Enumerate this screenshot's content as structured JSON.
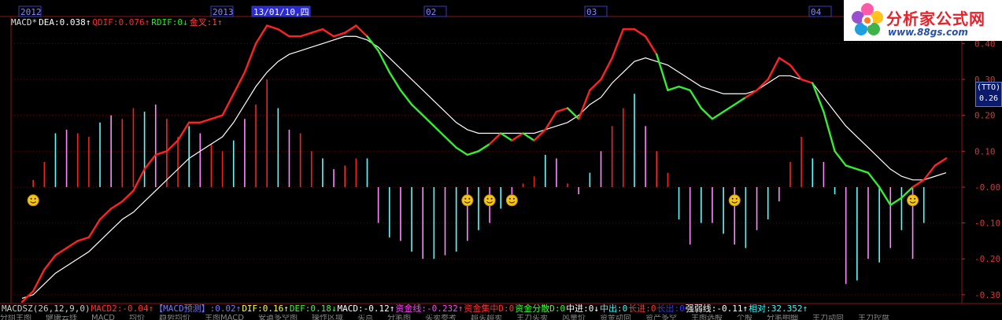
{
  "top_axis": {
    "labels": [
      "2012",
      "2013",
      "13/01/10,四",
      "02",
      "03",
      "04"
    ]
  },
  "logo": {
    "title": "分析家公式网",
    "url": "www.88gs.com"
  },
  "legend": {
    "items": [
      {
        "text": "MACD*",
        "color": "#dddddd"
      },
      {
        "text": "DEA:0.038↑",
        "color": "#ffffff"
      },
      {
        "text": "QDIF:0.076↑",
        "color": "#ff2a2a"
      },
      {
        "text": "RDIF:0↓",
        "color": "#22ee22"
      },
      {
        "text": "金叉:1↑",
        "color": "#ff4444"
      }
    ]
  },
  "price_tag": {
    "line1": "(TTO)",
    "line2": "0.26"
  },
  "footer": {
    "items": [
      {
        "text": "MACDSZ(26,12,9,0)",
        "color": "#cccccc"
      },
      {
        "text": "MACD2:-0.04↑",
        "color": "#ff3333"
      },
      {
        "text": "【MACD预测】:0.02↑",
        "color": "#7777ff"
      },
      {
        "text": "DIF:0.16↑",
        "color": "#ffff44"
      },
      {
        "text": "DEF:0.18↓",
        "color": "#33ff33"
      },
      {
        "text": "MACD:-0.12↑",
        "color": "#ffffff"
      },
      {
        "text": "资金线:-0.232↑",
        "color": "#ff44ff"
      },
      {
        "text": "资金集中D:0",
        "color": "#ff3333"
      },
      {
        "text": "资金分散D:0",
        "color": "#33ff33"
      },
      {
        "text": "中进:0↓",
        "color": "#ffffff"
      },
      {
        "text": "中出:0",
        "color": "#33ffff"
      },
      {
        "text": "长进:0",
        "color": "#ff3333"
      },
      {
        "text": "长出:0",
        "color": "#3333ff"
      },
      {
        "text": "强弱线:-0.11↑",
        "color": "#ffffff"
      },
      {
        "text": "相对:32.352↑",
        "color": "#33ffff"
      }
    ]
  },
  "tabs": {
    "items": [
      "分组主图",
      "健康云线",
      "MACD",
      "均价",
      "趋势均价",
      "主图MACD",
      "安道多空图",
      "操作区域",
      "买点",
      "分笔图",
      "买卖参考",
      "超买超卖",
      "主力买卖",
      "风量价",
      "资金动向",
      "资产多空",
      "主图选股",
      "个股",
      "分笔明细",
      "主力动向",
      "主力控盘"
    ]
  },
  "chart_data": {
    "type": "line",
    "title": "",
    "ylabel": "",
    "ylim": [
      -0.32,
      0.46
    ],
    "y_ticks": [
      "0.40",
      "0.30",
      "0.20",
      "0.10",
      "-0.00",
      "-0.10",
      "-0.20",
      "-0.30"
    ],
    "y_tick_values": [
      0.4,
      0.3,
      0.2,
      0.1,
      0.0,
      -0.1,
      -0.2,
      -0.3
    ],
    "x_range": [
      0,
      83
    ],
    "series": [
      {
        "name": "QDIF",
        "color_up": "#ff2222",
        "color_down": "#33ee33",
        "x": [
          0,
          1,
          2,
          3,
          4,
          5,
          6,
          7,
          8,
          9,
          10,
          11,
          12,
          13,
          14,
          15,
          16,
          17,
          18,
          19,
          20,
          21,
          22,
          23,
          24,
          25,
          26,
          27,
          28,
          29,
          30,
          31,
          32,
          33,
          34,
          35,
          36,
          37,
          38,
          39,
          40,
          41,
          42,
          43,
          44,
          45,
          46,
          47,
          48,
          49,
          50,
          51,
          52,
          53,
          54,
          55,
          56,
          57,
          58,
          59,
          60,
          61,
          62,
          63,
          64,
          65,
          66,
          67,
          68,
          69,
          70,
          71,
          72,
          73,
          74,
          75,
          76,
          77,
          78,
          79,
          80,
          81,
          82,
          83
        ],
        "values": [
          -0.32,
          -0.29,
          -0.23,
          -0.19,
          -0.17,
          -0.15,
          -0.14,
          -0.09,
          -0.06,
          -0.04,
          -0.01,
          0.05,
          0.09,
          0.1,
          0.13,
          0.18,
          0.18,
          0.19,
          0.2,
          0.26,
          0.32,
          0.4,
          0.45,
          0.44,
          0.42,
          0.42,
          0.43,
          0.44,
          0.42,
          0.43,
          0.45,
          0.42,
          0.38,
          0.32,
          0.27,
          0.23,
          0.2,
          0.17,
          0.14,
          0.11,
          0.09,
          0.1,
          0.12,
          0.15,
          0.13,
          0.15,
          0.13,
          0.16,
          0.21,
          0.22,
          0.19,
          0.27,
          0.3,
          0.36,
          0.44,
          0.44,
          0.42,
          0.37,
          0.27,
          0.28,
          0.27,
          0.22,
          0.19,
          0.21,
          0.23,
          0.25,
          0.27,
          0.3,
          0.36,
          0.34,
          0.3,
          0.29,
          0.21,
          0.1,
          0.06,
          0.05,
          0.04,
          0.0,
          -0.05,
          -0.03,
          0.0,
          0.02,
          0.06,
          0.08
        ]
      },
      {
        "name": "DEA",
        "color": "#ffffff",
        "x": [
          0,
          1,
          2,
          3,
          4,
          5,
          6,
          7,
          8,
          9,
          10,
          11,
          12,
          13,
          14,
          15,
          16,
          17,
          18,
          19,
          20,
          21,
          22,
          23,
          24,
          25,
          26,
          27,
          28,
          29,
          30,
          31,
          32,
          33,
          34,
          35,
          36,
          37,
          38,
          39,
          40,
          41,
          42,
          43,
          44,
          45,
          46,
          47,
          48,
          49,
          50,
          51,
          52,
          53,
          54,
          55,
          56,
          57,
          58,
          59,
          60,
          61,
          62,
          63,
          64,
          65,
          66,
          67,
          68,
          69,
          70,
          71,
          72,
          73,
          74,
          75,
          76,
          77,
          78,
          79,
          80,
          81,
          82,
          83
        ],
        "values": [
          -0.31,
          -0.3,
          -0.27,
          -0.24,
          -0.22,
          -0.2,
          -0.18,
          -0.15,
          -0.12,
          -0.09,
          -0.07,
          -0.04,
          -0.01,
          0.02,
          0.05,
          0.08,
          0.1,
          0.12,
          0.14,
          0.18,
          0.23,
          0.28,
          0.32,
          0.35,
          0.37,
          0.38,
          0.39,
          0.4,
          0.41,
          0.42,
          0.42,
          0.41,
          0.39,
          0.36,
          0.33,
          0.3,
          0.27,
          0.24,
          0.21,
          0.18,
          0.16,
          0.15,
          0.15,
          0.15,
          0.15,
          0.15,
          0.15,
          0.16,
          0.17,
          0.18,
          0.2,
          0.23,
          0.25,
          0.29,
          0.32,
          0.35,
          0.36,
          0.35,
          0.34,
          0.32,
          0.3,
          0.28,
          0.27,
          0.26,
          0.26,
          0.26,
          0.27,
          0.29,
          0.31,
          0.31,
          0.3,
          0.29,
          0.25,
          0.21,
          0.17,
          0.14,
          0.11,
          0.08,
          0.05,
          0.03,
          0.02,
          0.02,
          0.03,
          0.04
        ]
      }
    ],
    "histogram": {
      "x": [
        1,
        2,
        3,
        4,
        5,
        6,
        7,
        8,
        9,
        10,
        11,
        12,
        13,
        14,
        15,
        16,
        17,
        18,
        19,
        20,
        21,
        22,
        23,
        24,
        25,
        26,
        27,
        28,
        29,
        30,
        31,
        32,
        33,
        34,
        35,
        36,
        37,
        38,
        39,
        40,
        41,
        42,
        43,
        44,
        45,
        46,
        47,
        48,
        49,
        50,
        51,
        52,
        53,
        54,
        55,
        56,
        57,
        58,
        59,
        60,
        61,
        62,
        63,
        64,
        65,
        66,
        67,
        68,
        69,
        70,
        71,
        72,
        73,
        74,
        75,
        76,
        77,
        78,
        79,
        80,
        81
      ],
      "values": [
        0.02,
        0.07,
        0.15,
        0.16,
        0.15,
        0.14,
        0.18,
        0.2,
        0.19,
        0.22,
        0.21,
        0.23,
        0.19,
        0.14,
        0.17,
        0.15,
        0.12,
        0.1,
        0.13,
        0.19,
        0.23,
        0.3,
        0.22,
        0.16,
        0.15,
        0.1,
        0.08,
        0.05,
        0.06,
        0.08,
        0.08,
        -0.1,
        -0.14,
        -0.15,
        -0.18,
        -0.2,
        -0.2,
        -0.19,
        -0.18,
        -0.15,
        -0.12,
        -0.1,
        -0.06,
        -0.02,
        0.01,
        0.03,
        0.09,
        0.08,
        0.01,
        -0.02,
        0.04,
        0.1,
        0.17,
        0.22,
        0.26,
        0.17,
        0.1,
        0.04,
        -0.09,
        -0.16,
        -0.1,
        -0.1,
        -0.13,
        -0.16,
        -0.17,
        -0.12,
        -0.09,
        -0.04,
        0.07,
        0.14,
        0.08,
        0.07,
        -0.02,
        -0.27,
        -0.26,
        -0.2,
        -0.21,
        -0.17,
        -0.12,
        -0.2,
        -0.1
      ],
      "color_pos": [
        "#ff2222",
        "#ee2222",
        "#55ffff",
        "#ff88ff"
      ],
      "color_neg": [
        "#55ffff",
        "#ff88ff"
      ]
    },
    "markers": {
      "x": [
        1,
        40,
        42,
        44,
        64,
        80
      ],
      "value": -0.015,
      "symbol": "smiley"
    }
  }
}
